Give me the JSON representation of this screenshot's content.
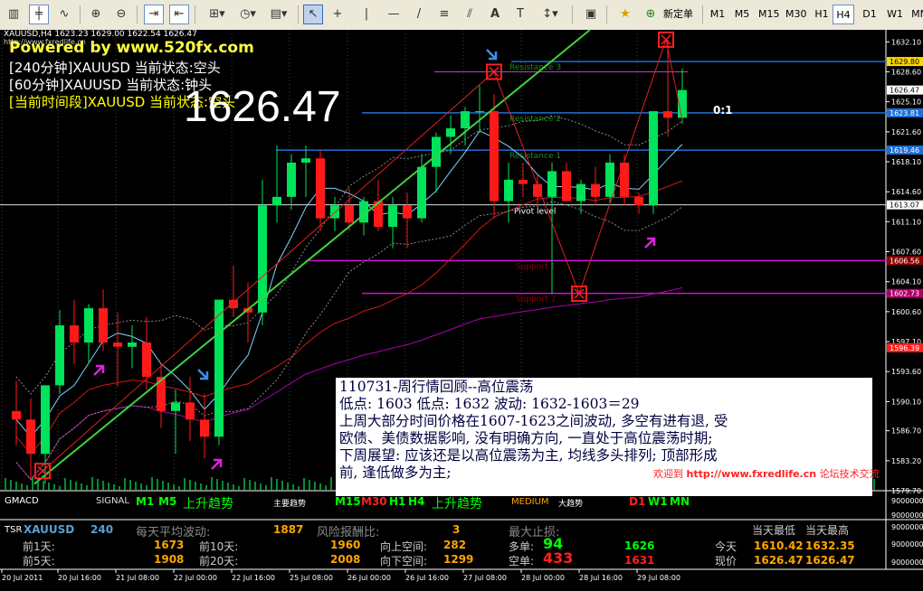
{
  "toolbar": {
    "new_order_label": "新定单",
    "timeframes": [
      "M1",
      "M5",
      "M15",
      "M30",
      "H1",
      "H4",
      "D1",
      "W1",
      "MN"
    ],
    "active_timeframe": "H4"
  },
  "header": {
    "symbol_line": "XAUUSD,H4  1623.23 1629.00 1622.54 1626.47",
    "url_small": "http://www.fxredlife.cn",
    "powered": "Powered by www.520fx.com",
    "status_240": "[240分钟]XAUUSD 当前状态:空头",
    "status_60": "[60分钟]XAUUSD 当前状态:钟头",
    "status_now": "[当前时间段]XAUUSD 当前状态:空头",
    "big_price": "1626.47",
    "ratio": "0:1"
  },
  "levels": {
    "resistance3": "Resistance 3",
    "resistance2": "Resistance 2",
    "resistance1": "Resistance 1",
    "pivot": "Pivot level",
    "support1": "Support 1",
    "support2": "Support 2"
  },
  "price_axis": {
    "ticks": [
      "1632.10",
      "1628.60",
      "1625.10",
      "1621.60",
      "1618.10",
      "1614.60",
      "1611.10",
      "1607.60",
      "1604.10",
      "1600.60",
      "1597.10",
      "1593.60",
      "1590.10",
      "1586.70",
      "1583.20",
      "1579.70"
    ],
    "tags": [
      {
        "label": "1629.80",
        "color": "#ffd700",
        "text": "#000"
      },
      {
        "label": "1626.47",
        "color": "#ffffff",
        "text": "#000"
      },
      {
        "label": "1623.81",
        "color": "#1e6fd6",
        "text": "#fff"
      },
      {
        "label": "1619.46",
        "color": "#1e6fd6",
        "text": "#fff"
      },
      {
        "label": "1613.07",
        "color": "#ffffff",
        "text": "#000"
      },
      {
        "label": "1606.56",
        "color": "#8b0000",
        "text": "#fff"
      },
      {
        "label": "1602.73",
        "color": "#b0006a",
        "text": "#fff"
      },
      {
        "label": "1596.39",
        "color": "#ff2020",
        "text": "#fff"
      }
    ]
  },
  "time_axis": {
    "ticks": [
      "20 Jul 2011",
      "20 Jul 16:00",
      "21 Jul 08:00",
      "22 Jul 00:00",
      "22 Jul 16:00",
      "25 Jul 08:00",
      "26 Jul 00:00",
      "26 Jul 16:00",
      "27 Jul 08:00",
      "28 Jul 00:00",
      "28 Jul 16:00",
      "29 Jul 08:00"
    ]
  },
  "review": {
    "line1": "110731-周行情回顾--高位震荡",
    "line2": "低点: 1603   低点: 1632  波动: 1632-1603＝29",
    "line3": "上周大部分时间价格在1607-1623之间波动, 多空有进有退, 受",
    "line4": "欧债、美债数据影响, 没有明确方向, 一直处于高位震荡时期;",
    "line5": "下周展望: 应该还是以高位震荡为主, 均线多头排列; 顶部形成",
    "line6": "前, 逢低做多为主;"
  },
  "welcome": {
    "prefix": "欢迎到",
    "url": "http://www.fxredlife.cn",
    "suffix": "论坛技术交流"
  },
  "gmacd": {
    "name": "GMACD",
    "signal": "SIGNAL",
    "m1": "M1",
    "m5": "M5",
    "trend1": "上升趋势",
    "main_trend": "主要趋势",
    "m15": "M15",
    "m30": "M30",
    "h1": "H1",
    "h4": "H4",
    "trend2": "上升趋势",
    "medium": "MEDIUM",
    "big_trend": "大趋势",
    "d1": "D1",
    "w1": "W1",
    "mn": "MN",
    "scale": [
      "9000000",
      "9000000"
    ]
  },
  "tsr": {
    "name": "TSR",
    "symbol": "XAUUSD",
    "period": "240",
    "avg_label": "每天平均波动:",
    "avg_value": "1887",
    "rr_label": "风险报酬比:",
    "rr_value": "3",
    "maxloss_label": "最大止损:",
    "day_low_label": "当天最低",
    "day_high_label": "当天最高",
    "prev1_label": "前1天:",
    "prev1": "1673",
    "prev5_label": "前5天:",
    "prev5": "1908",
    "prev10_label": "前10天:",
    "prev10": "1960",
    "prev20_label": "前20天:",
    "prev20": "2008",
    "up_label": "向上空间:",
    "up_value": "282",
    "down_label": "向下空间:",
    "down_value": "1299",
    "long_label": "多单:",
    "long_value": "94",
    "long_price": "1626",
    "short_label": "空单:",
    "short_value": "433",
    "short_price": "1631",
    "today_label": "今天",
    "today_low": "1610.42",
    "today_high": "1632.35",
    "now_label": "现价",
    "now_low": "1626.47",
    "now_high": "1626.47",
    "scale": [
      "9000000",
      "9000000",
      "9000000"
    ]
  },
  "chart_data": {
    "type": "candlestick",
    "symbol": "XAUUSD",
    "timeframe": "H4",
    "ylim": [
      1579.7,
      1633.5
    ],
    "candles": [
      [
        1589.0,
        1592.5,
        1585.0,
        1588.0
      ],
      [
        1588.0,
        1590.5,
        1581.0,
        1584.0
      ],
      [
        1584.0,
        1592.0,
        1580.5,
        1592.0
      ],
      [
        1592.0,
        1600.8,
        1591.0,
        1599.0
      ],
      [
        1599.0,
        1602.0,
        1594.5,
        1597.0
      ],
      [
        1597.0,
        1601.5,
        1594.5,
        1601.0
      ],
      [
        1601.0,
        1603.2,
        1596.0,
        1597.0
      ],
      [
        1597.0,
        1600.5,
        1591.8,
        1596.5
      ],
      [
        1596.5,
        1599.0,
        1594.0,
        1597.0
      ],
      [
        1597.0,
        1600.0,
        1591.5,
        1593.0
      ],
      [
        1593.0,
        1594.5,
        1587.0,
        1589.0
      ],
      [
        1589.0,
        1591.5,
        1584.0,
        1590.0
      ],
      [
        1590.0,
        1593.0,
        1585.5,
        1588.0
      ],
      [
        1588.0,
        1591.0,
        1583.5,
        1586.0
      ],
      [
        1586.0,
        1602.0,
        1585.0,
        1602.0
      ],
      [
        1602.0,
        1606.0,
        1600.0,
        1601.0
      ],
      [
        1601.0,
        1604.0,
        1597.0,
        1600.5
      ],
      [
        1600.5,
        1616.0,
        1599.0,
        1613.0
      ],
      [
        1613.0,
        1620.0,
        1611.0,
        1614.0
      ],
      [
        1614.0,
        1619.0,
        1612.5,
        1618.0
      ],
      [
        1618.0,
        1620.0,
        1614.0,
        1618.5
      ],
      [
        1618.5,
        1619.5,
        1610.0,
        1611.5
      ],
      [
        1611.5,
        1614.0,
        1610.0,
        1613.0
      ],
      [
        1613.0,
        1615.0,
        1610.0,
        1611.0
      ],
      [
        1611.0,
        1614.0,
        1609.5,
        1613.5
      ],
      [
        1613.5,
        1616.0,
        1610.0,
        1610.5
      ],
      [
        1610.5,
        1614.0,
        1608.0,
        1613.0
      ],
      [
        1613.0,
        1614.5,
        1608.0,
        1611.5
      ],
      [
        1611.5,
        1619.0,
        1611.0,
        1617.5
      ],
      [
        1617.5,
        1621.5,
        1614.5,
        1621.0
      ],
      [
        1621.0,
        1623.5,
        1619.0,
        1622.0
      ],
      [
        1622.0,
        1624.5,
        1620.0,
        1624.0
      ],
      [
        1624.0,
        1627.0,
        1621.5,
        1624.0
      ],
      [
        1624.0,
        1626.0,
        1611.5,
        1613.5
      ],
      [
        1613.5,
        1618.0,
        1611.0,
        1616.0
      ],
      [
        1616.0,
        1618.0,
        1614.0,
        1615.5
      ],
      [
        1615.5,
        1616.5,
        1613.0,
        1614.0
      ],
      [
        1614.0,
        1618.0,
        1602.7,
        1617.0
      ],
      [
        1617.0,
        1618.0,
        1614.0,
        1613.5
      ],
      [
        1613.5,
        1616.0,
        1612.0,
        1615.5
      ],
      [
        1615.5,
        1617.5,
        1613.0,
        1614.0
      ],
      [
        1614.0,
        1619.0,
        1613.0,
        1618.0
      ],
      [
        1618.0,
        1619.0,
        1613.0,
        1614.0
      ],
      [
        1614.0,
        1614.5,
        1612.0,
        1613.0
      ],
      [
        1613.0,
        1624.0,
        1612.0,
        1624.0
      ],
      [
        1624.0,
        1632.35,
        1621.0,
        1623.23
      ],
      [
        1623.23,
        1629.0,
        1622.54,
        1626.47
      ]
    ],
    "price_levels": {
      "resistance3": 1629.8,
      "resistance2": 1623.81,
      "resistance1": 1619.46,
      "pivot": 1613.07,
      "support1": 1606.56,
      "support2": 1602.73
    }
  }
}
